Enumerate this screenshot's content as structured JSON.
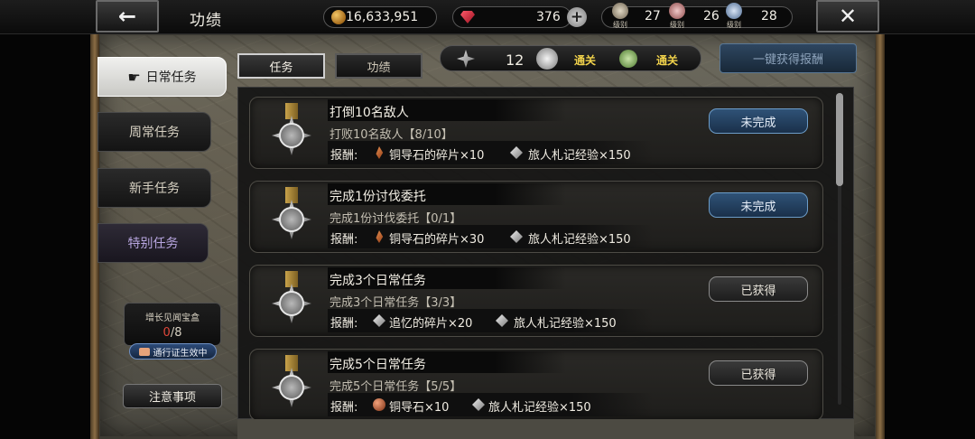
{
  "header": {
    "title": "功绩",
    "gold": "16,633,951",
    "gems": "376",
    "ranks": [
      {
        "label": "级别",
        "value": "27"
      },
      {
        "label": "级别",
        "value": "26"
      },
      {
        "label": "级别",
        "value": "28"
      }
    ]
  },
  "nav": {
    "items": [
      {
        "label": "日常任务",
        "active": true
      },
      {
        "label": "周常任务"
      },
      {
        "label": "新手任务"
      },
      {
        "label": "特别任务"
      }
    ],
    "chest": {
      "title": "增长见闻宝盒",
      "current": "0",
      "total": "/8"
    },
    "pass_badge": "通行证生效中",
    "notice": "注意事项"
  },
  "tabs": [
    {
      "label": "任务",
      "active": true
    },
    {
      "label": "功绩"
    }
  ],
  "stats": {
    "count": "12",
    "clear1": "通关",
    "clear2": "通关"
  },
  "claim_all": "一键获得报酬",
  "reward_label": "报酬:",
  "missions": [
    {
      "title": "打倒10名敌人",
      "progress": "打败10名敌人【8/10】",
      "reward1": "铜导石的碎片×10",
      "reward2": "旅人札记经验×150",
      "status": "未完成"
    },
    {
      "title": "完成1份讨伐委托",
      "progress": "完成1份讨伐委托【0/1】",
      "reward1": "铜导石的碎片×30",
      "reward2": "旅人札记经验×150",
      "status": "未完成"
    },
    {
      "title": "完成3个日常任务",
      "progress": "完成3个日常任务【3/3】",
      "reward1": "追忆的碎片×20",
      "reward2": "旅人札记经验×150",
      "status": "已获得"
    },
    {
      "title": "完成5个日常任务",
      "progress": "完成5个日常任务【5/5】",
      "reward1": "铜导石×10",
      "reward2": "旅人札记经验×150",
      "status": "已获得"
    }
  ]
}
